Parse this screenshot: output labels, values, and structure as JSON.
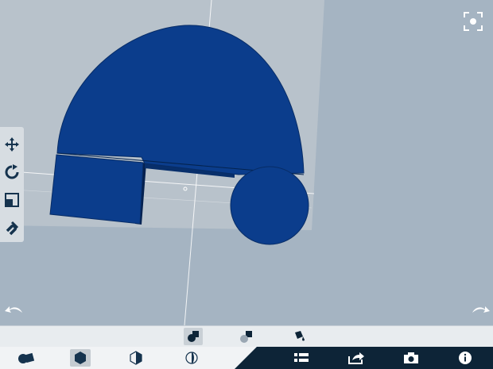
{
  "app": {
    "colors": {
      "background": "#a5b4c2",
      "grid_plane": "#bcc6cf",
      "shape_fill": "#0b3d8c",
      "shape_dark": "#062a63",
      "toolbar_bg": "#d7dde2",
      "bottom_dark": "#0d2437",
      "icon_dark": "#15334e"
    }
  },
  "viewport": {
    "fit_view_icon": "fit-view-icon",
    "undo_icon": "undo-arrow-icon",
    "redo_icon": "redo-arrow-icon"
  },
  "left_toolbar": {
    "tools": [
      {
        "name": "move",
        "icon": "move-arrows-icon"
      },
      {
        "name": "rotate",
        "icon": "rotate-icon"
      },
      {
        "name": "scale",
        "icon": "scale-icon"
      },
      {
        "name": "snap",
        "icon": "magnet-icon"
      }
    ]
  },
  "mode_bar": {
    "items": [
      {
        "name": "solid",
        "icon": "solid-shape-icon",
        "selected": true
      },
      {
        "name": "hole",
        "icon": "hole-shape-icon",
        "selected": false
      },
      {
        "name": "paint",
        "icon": "paint-bucket-icon",
        "selected": false
      }
    ]
  },
  "bottom_bar": {
    "left_items": [
      {
        "name": "shapes",
        "icon": "shapes-icon"
      },
      {
        "name": "solid-view",
        "icon": "hexagon-solid-icon",
        "selected": true
      },
      {
        "name": "half-view",
        "icon": "hexagon-half-icon"
      },
      {
        "name": "outline-view",
        "icon": "sphere-outline-icon"
      }
    ],
    "right_items": [
      {
        "name": "list",
        "icon": "list-icon"
      },
      {
        "name": "share",
        "icon": "share-icon"
      },
      {
        "name": "camera",
        "icon": "camera-icon"
      },
      {
        "name": "info",
        "icon": "info-icon"
      }
    ]
  }
}
